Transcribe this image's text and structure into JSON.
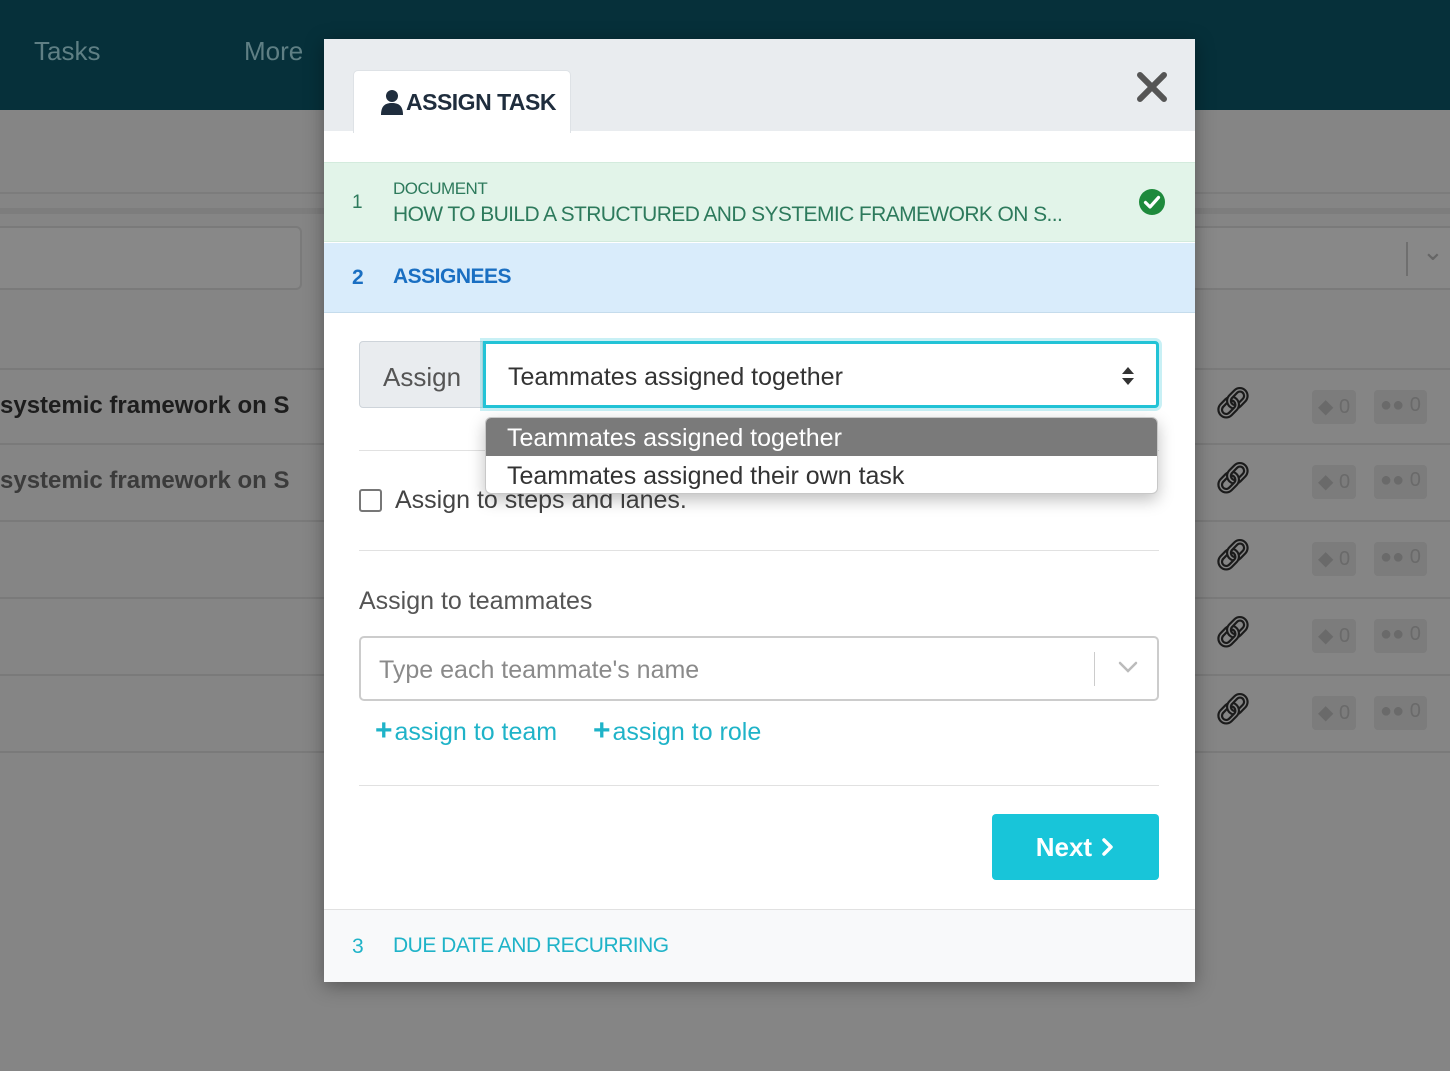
{
  "background": {
    "nav": [
      "Tasks",
      "More"
    ],
    "rows": [
      {
        "text": "systemic framework on S",
        "tags": "0",
        "members": "0"
      },
      {
        "text": "systemic framework on S",
        "tags": "0",
        "members": "0"
      },
      {
        "text": "",
        "tags": "0",
        "members": "0"
      },
      {
        "text": "",
        "tags": "0",
        "members": "0"
      },
      {
        "text": "",
        "tags": "0",
        "members": "0"
      }
    ]
  },
  "modal": {
    "tab_label": "ASSIGN TASK",
    "tab_icon": "user-icon",
    "close_icon": "close-icon",
    "steps": [
      {
        "number": "1",
        "label": "DOCUMENT",
        "value": "HOW TO BUILD A STRUCTURED AND SYSTEMIC FRAMEWORK ON S...",
        "status": "complete"
      },
      {
        "number": "2",
        "label": "ASSIGNEES",
        "status": "active"
      },
      {
        "number": "3",
        "label": "DUE DATE AND RECURRING",
        "status": "pending"
      }
    ],
    "assign_addon": "Assign",
    "assign_select": {
      "value": "Teammates assigned together",
      "options": [
        "Teammates assigned together",
        "Teammates assigned their own task"
      ]
    },
    "steps_checkbox_label": "Assign to steps and lanes.",
    "teammates_label": "Assign to teammates",
    "teammates_placeholder": "Type each teammate's name",
    "assign_to_team": "assign to team",
    "assign_to_role": "assign to role",
    "next_label": "Next"
  },
  "colors": {
    "accent": "#18c5d9",
    "topbar": "#06303a",
    "step_complete": "#2d7a5c",
    "step_active": "#1a6fc2"
  }
}
